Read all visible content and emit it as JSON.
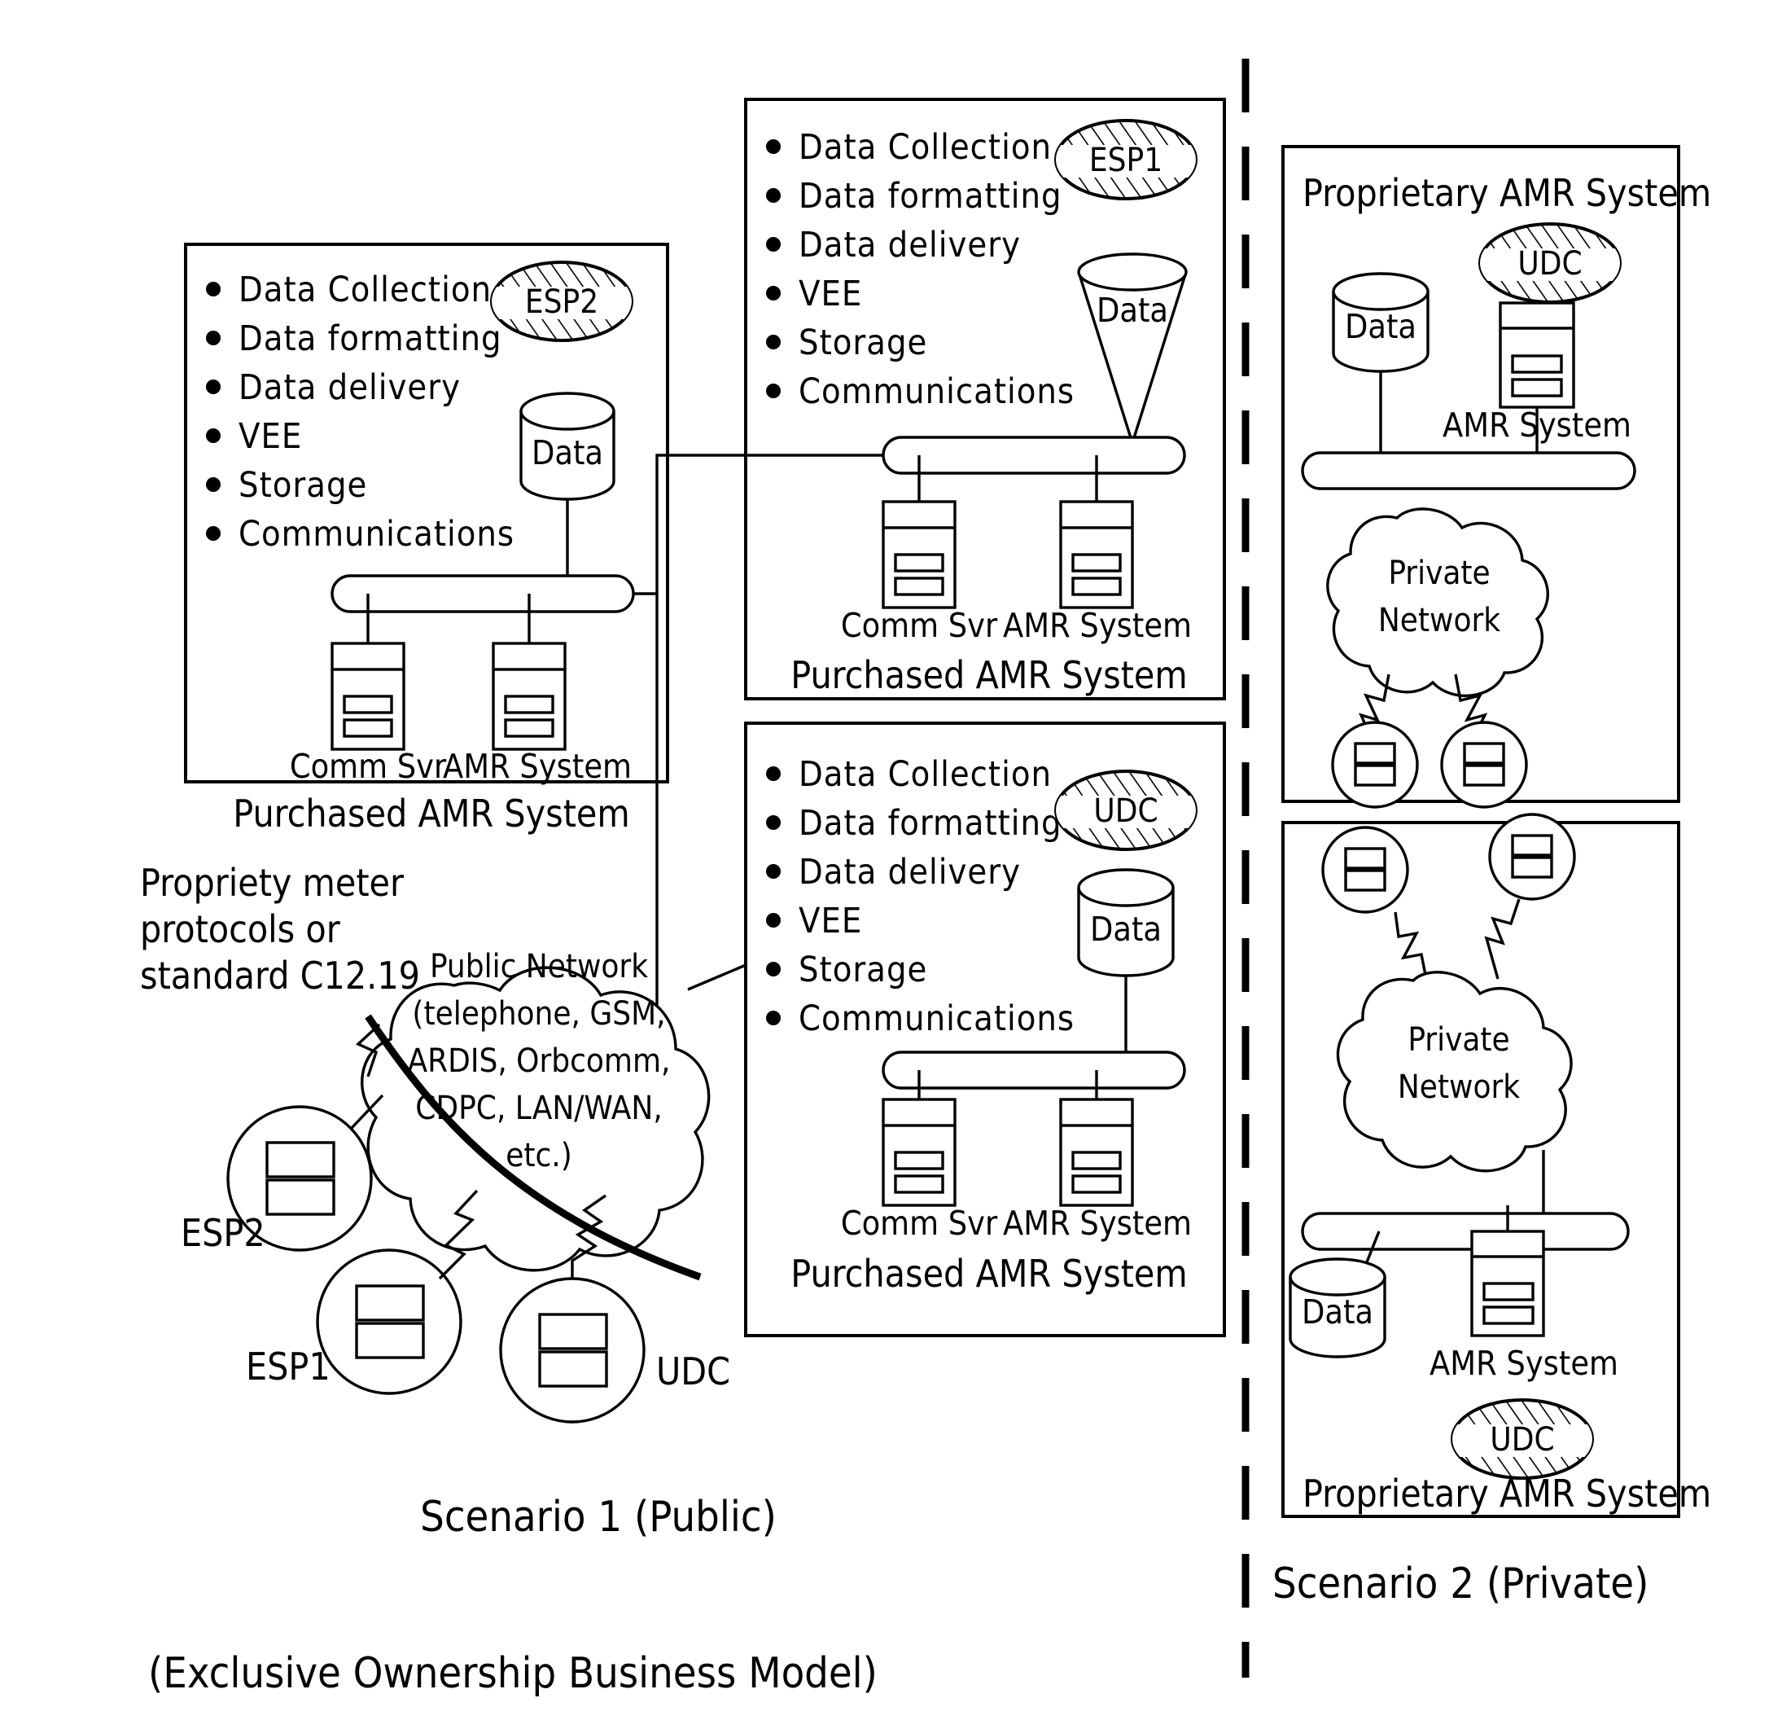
{
  "figure": {
    "scenario1_caption": "Scenario 1  (Public)",
    "scenario2_caption": "Scenario 2  (Private)",
    "model_caption": "(Exclusive Ownership Business Model)"
  },
  "capability_list": [
    "Data  Collection",
    "Data  formatting",
    "Data  delivery",
    "VEE",
    "Storage",
    "Communications"
  ],
  "scenario1": {
    "esp2_panel": {
      "tag": "ESP2",
      "db_label": "Data",
      "node_labels": [
        "Comm  Svr",
        "AMR  System"
      ],
      "panel_caption": "Purchased  AMR  System"
    },
    "esp1_panel": {
      "tag": "ESP1",
      "db_label": "Data",
      "node_labels": [
        "Comm  Svr",
        "AMR  System"
      ],
      "panel_caption": "Purchased  AMR  System"
    },
    "udc_panel": {
      "tag": "UDC",
      "db_label": "Data",
      "node_labels": [
        "Comm  Svr",
        "AMR  System"
      ],
      "panel_caption": "Purchased  AMR  System"
    },
    "protocol_note": [
      "Propriety  meter",
      "protocols or",
      "standard  C12.19"
    ],
    "public_cloud": {
      "lines": [
        "Public  Network",
        "(telephone,  GSM,",
        "ARDIS,  Orbcomm,",
        "CDPC,  LAN/WAN,",
        "etc.)"
      ]
    },
    "meters": [
      {
        "label": "ESP2"
      },
      {
        "label": "ESP1"
      },
      {
        "label": "UDC"
      }
    ]
  },
  "scenario2": {
    "top_panel": {
      "title": "Proprietary  AMR  System",
      "tag": "UDC",
      "db_label": "Data",
      "node_label": "AMR  System",
      "cloud_lines": [
        "Private",
        "Network"
      ],
      "meter_count": 2
    },
    "bottom_panel": {
      "cloud_lines": [
        "Private",
        "Network"
      ],
      "db_label": "Data",
      "node_label": "AMR  System",
      "tag": "UDC",
      "title": "Proprietary  AMR  System",
      "meter_count": 2
    }
  },
  "colors": {
    "ink": "#000000",
    "paper": "#ffffff"
  }
}
